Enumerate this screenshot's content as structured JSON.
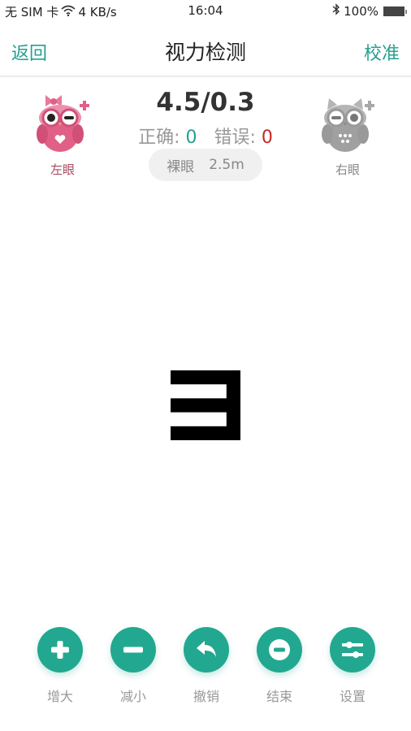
{
  "status_bar": {
    "carrier": "无 SIM 卡",
    "network_speed": "4 KB/s",
    "time": "16:04",
    "battery": "100%",
    "icons": [
      "wifi-icon",
      "bluetooth-icon",
      "battery-icon"
    ]
  },
  "nav": {
    "back_label": "返回",
    "title": "视力检测",
    "calibrate_label": "校准"
  },
  "eyes": {
    "left": {
      "label": "左眼",
      "state": "active",
      "color": "#e06088"
    },
    "right": {
      "label": "右眼",
      "state": "inactive",
      "color": "#aaaaaa"
    }
  },
  "result": {
    "score": "4.5/0.3",
    "correct_label": "正确:",
    "correct_value": "0",
    "wrong_label": "错误:",
    "wrong_value": "0"
  },
  "mode": {
    "type": "裸眼",
    "distance": "2.5m"
  },
  "optotype": {
    "direction": "left"
  },
  "toolbar": {
    "accent_color": "#22a890",
    "items": [
      {
        "label": "增大",
        "icon": "plus-icon"
      },
      {
        "label": "减小",
        "icon": "minus-icon"
      },
      {
        "label": "撤销",
        "icon": "undo-icon"
      },
      {
        "label": "结束",
        "icon": "stop-icon"
      },
      {
        "label": "设置",
        "icon": "sliders-icon"
      }
    ]
  }
}
